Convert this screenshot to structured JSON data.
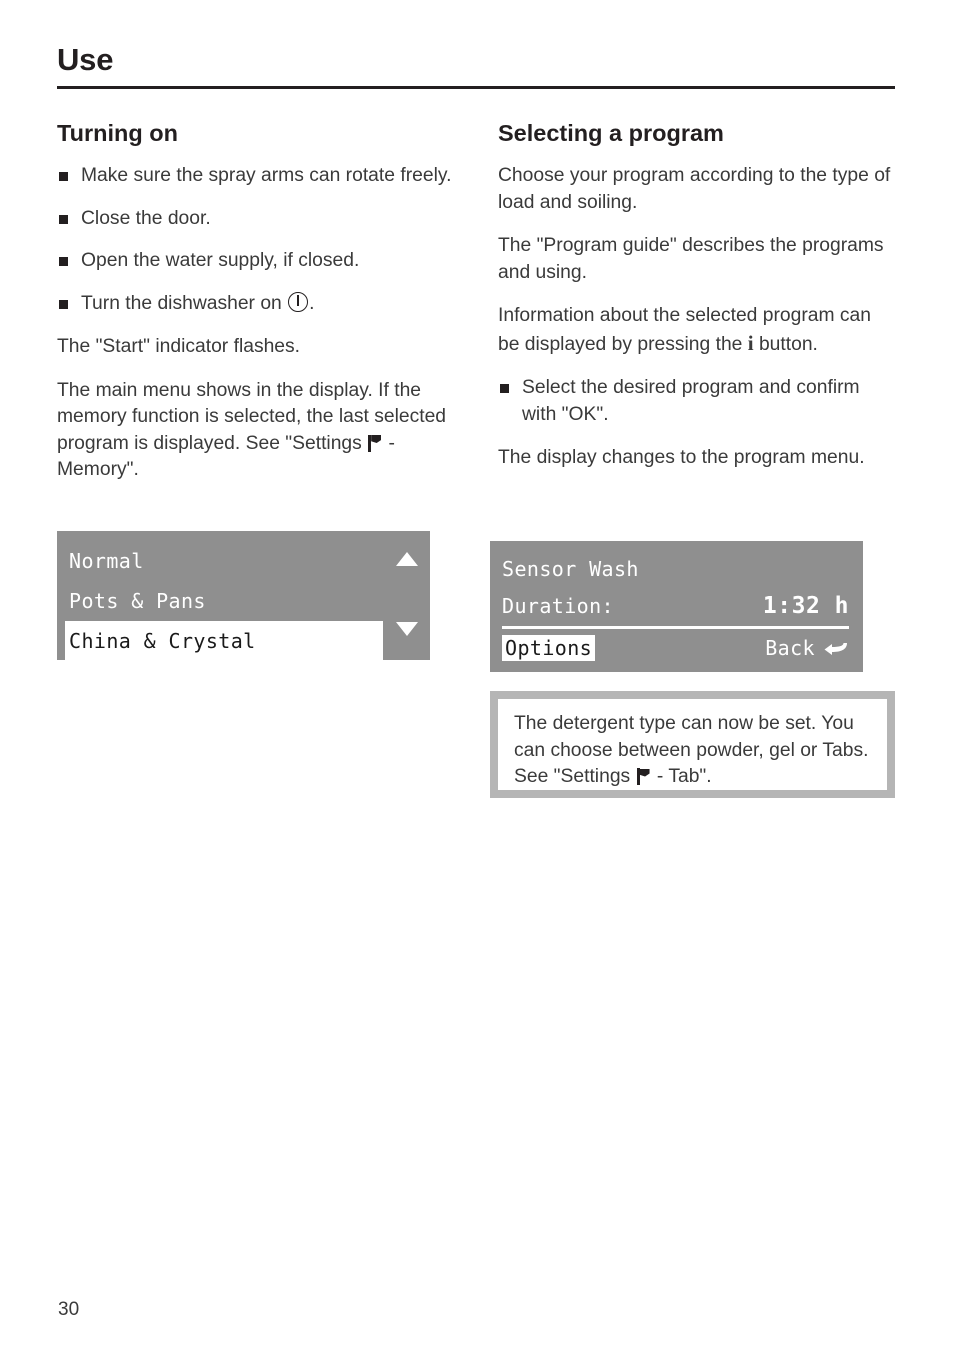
{
  "page": {
    "chapter_title": "Use",
    "page_number": "30"
  },
  "left_column": {
    "heading": "Turning on",
    "bullets": [
      {
        "text": "Make sure the spray arms can rotate freely."
      },
      {
        "text": "Close the door."
      },
      {
        "text": "Open the water supply, if closed."
      },
      {
        "text_before_icon": "Turn the dishwasher on ",
        "icon": "power-icon",
        "text_after_icon": "."
      }
    ],
    "paragraphs": [
      "The \"Start\" indicator flashes."
    ],
    "memory_paragraph": {
      "before_icon": "The main menu shows in the display. If the memory function is selected, the last selected program is displayed. See \"Settings ",
      "icon": "flag-icon",
      "after_icon": " - Memory\"."
    },
    "lcd_main_menu": {
      "rows": [
        {
          "label": "Normal",
          "selected": false
        },
        {
          "label": "Pots & Pans",
          "selected": false
        },
        {
          "label": "China & Crystal",
          "selected": true
        }
      ],
      "scroll_up_icon": "triangle-up-icon",
      "scroll_down_icon": "triangle-down-icon",
      "background_color": "#8f8f8f",
      "text_color": "#ffffff",
      "selected_background": "#ffffff",
      "selected_text_color": "#1a1a1a"
    }
  },
  "right_column": {
    "heading": "Selecting a program",
    "paragraphs": [
      "Choose your program according to the type of load and soiling.",
      "The \"Program guide\" describes the programs and using."
    ],
    "info_button_paragraph": {
      "before_icon": "Information about the selected program can be displayed by pressing the ",
      "icon": "info-i-icon",
      "icon_label": "i",
      "after_icon": " button."
    },
    "bullets": [
      {
        "text": "Select the desired program and confirm with \"OK\"."
      }
    ],
    "closing_paragraph": "The display changes to the program menu.",
    "lcd_program_menu": {
      "program_name": "Sensor Wash",
      "duration_label": "Duration:",
      "duration_value": "1:32 h",
      "options_label": "Options",
      "back_label": "Back",
      "back_icon": "return-arrow-icon",
      "background_color": "#8f8f8f",
      "text_color": "#ffffff",
      "highlight_background": "#ffffff"
    },
    "note_box": {
      "before_icon": "The detergent type can now be set. You can choose between powder, gel or Tabs. See \"Settings ",
      "icon": "flag-icon",
      "after_icon": " - Tab\".",
      "border_color": "#b5b5b5",
      "background_color": "#ffffff"
    }
  }
}
